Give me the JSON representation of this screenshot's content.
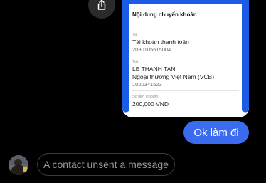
{
  "receipt": {
    "title": "Nội dung chuyển khoản",
    "from_label": "Từ",
    "from_account_type": "Tài khoản thanh toán",
    "from_account_number": "2030105615004",
    "to_label": "Tới",
    "to_name": "LE THANH TAN",
    "to_bank": "Ngoại thương Việt Nam (VCB)",
    "to_account_number": "1020341523",
    "amount_label": "Số tiền chuyển",
    "amount": "200,000 VND"
  },
  "messages": {
    "outgoing_text": "Ok làm đi",
    "unsent_notice": "A contact unsent a message"
  },
  "colors": {
    "bubble_blue": "#3b6cf0",
    "receipt_blue": "#1a5ce5",
    "background": "#000000"
  },
  "icons": {
    "share": "share-icon"
  }
}
